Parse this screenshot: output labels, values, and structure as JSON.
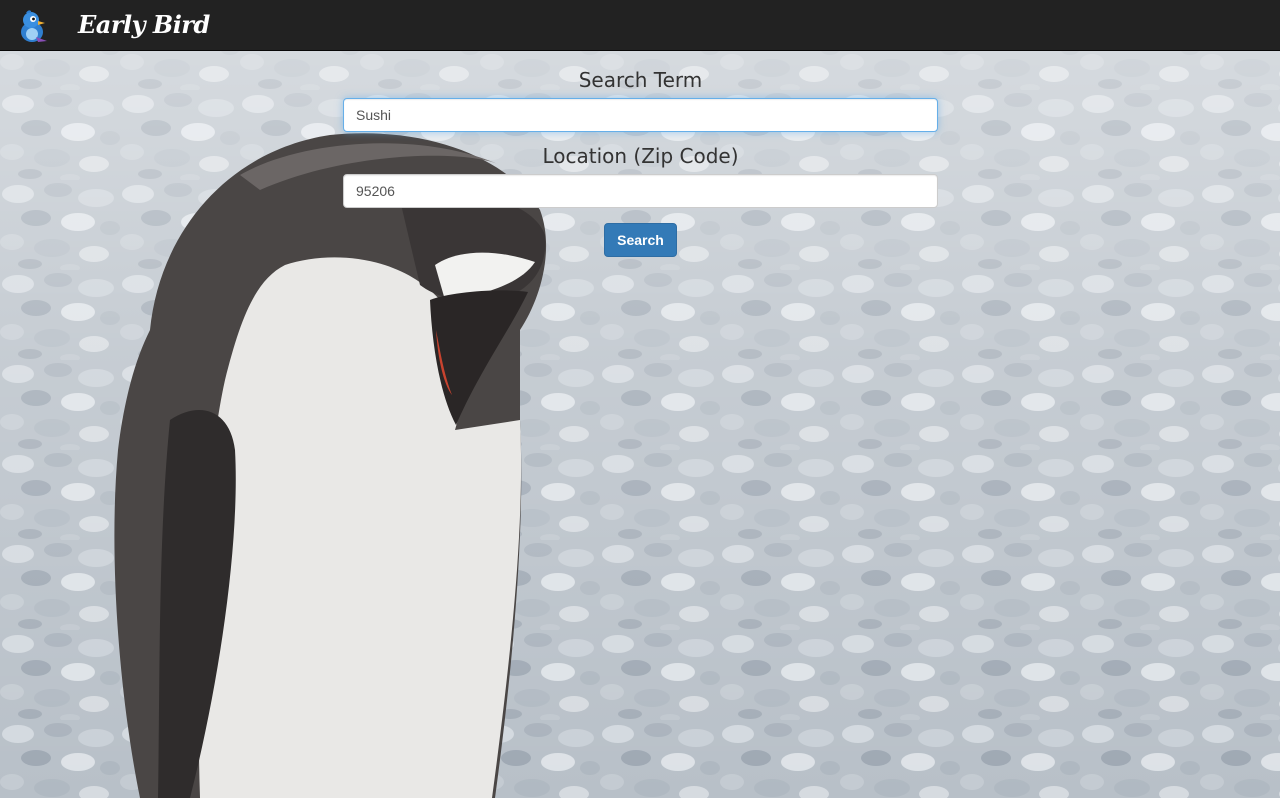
{
  "navbar": {
    "brand_name": "Early Bird",
    "logo_icon": "bird-logo-icon",
    "background": "#222222"
  },
  "search_form": {
    "term_label": "Search Term",
    "term_value": "Sushi",
    "location_label": "Location (Zip Code)",
    "location_value": "95206",
    "submit_label": "Search",
    "accent": "#337ab7"
  },
  "background_image": {
    "subject": "penguin-on-pebbles-photo"
  }
}
